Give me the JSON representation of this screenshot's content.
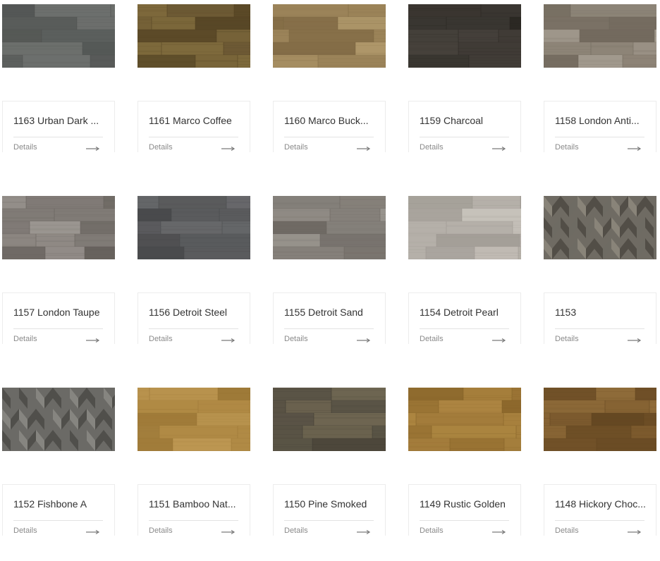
{
  "products": [
    {
      "title": "1163 Urban Dark ...",
      "details_label": "Details",
      "icon": "arrow-right-icon",
      "swatch": {
        "style": "plank",
        "base": "#6c6f6d",
        "light": "#8b8e8b",
        "dark": "#4a4d4b"
      }
    },
    {
      "title": "1161 Marco Coffee",
      "details_label": "Details",
      "icon": "arrow-right-icon",
      "swatch": {
        "style": "plank",
        "base": "#6d5a34",
        "light": "#85703f",
        "dark": "#4d3d1f"
      }
    },
    {
      "title": "1160 Marco Buck...",
      "details_label": "Details",
      "icon": "arrow-right-icon",
      "swatch": {
        "style": "plank",
        "base": "#9b8359",
        "light": "#b39c6e",
        "dark": "#7a6440"
      }
    },
    {
      "title": "1159 Charcoal",
      "details_label": "Details",
      "icon": "arrow-right-icon",
      "swatch": {
        "style": "plank",
        "base": "#3a3631",
        "light": "#4a453f",
        "dark": "#27241f"
      }
    },
    {
      "title": "1158 London Anti...",
      "details_label": "Details",
      "icon": "arrow-right-icon",
      "swatch": {
        "style": "plank",
        "base": "#8d8477",
        "light": "#aaa296",
        "dark": "#6b6357"
      }
    },
    {
      "title": "1157 London Taupe",
      "details_label": "Details",
      "icon": "arrow-right-icon",
      "swatch": {
        "style": "plank",
        "base": "#807b76",
        "light": "#a19c97",
        "dark": "#5f5a55"
      }
    },
    {
      "title": "1156 Detroit Steel",
      "details_label": "Details",
      "icon": "arrow-right-icon",
      "swatch": {
        "style": "plank",
        "base": "#5a5b5d",
        "light": "#6e6f71",
        "dark": "#454648"
      }
    },
    {
      "title": "1155 Detroit Sand",
      "details_label": "Details",
      "icon": "arrow-right-icon",
      "swatch": {
        "style": "plank",
        "base": "#85807a",
        "light": "#a09b95",
        "dark": "#67625c"
      }
    },
    {
      "title": "1154 Detroit Pearl",
      "details_label": "Details",
      "icon": "arrow-right-icon",
      "swatch": {
        "style": "plank",
        "base": "#b5b0a9",
        "light": "#cbc6bf",
        "dark": "#98938c"
      }
    },
    {
      "title": "1153",
      "details_label": "Details",
      "icon": "arrow-right-icon",
      "swatch": {
        "style": "herringbone",
        "base": "#6f6b63",
        "light": "#8e887d",
        "dark": "#4d4942"
      }
    },
    {
      "title": "1152 Fishbone A",
      "details_label": "Details",
      "icon": "arrow-right-icon",
      "swatch": {
        "style": "herringbone",
        "base": "#6b6a66",
        "light": "#8b8985",
        "dark": "#4b4a46"
      }
    },
    {
      "title": "1151 Bamboo Nat...",
      "details_label": "Details",
      "icon": "arrow-right-icon",
      "swatch": {
        "style": "plank",
        "base": "#b08a45",
        "light": "#c29d58",
        "dark": "#987434"
      }
    },
    {
      "title": "1150 Pine Smoked",
      "details_label": "Details",
      "icon": "arrow-right-icon",
      "swatch": {
        "style": "plank",
        "base": "#5a5446",
        "light": "#756c55",
        "dark": "#3c382f"
      }
    },
    {
      "title": "1149 Rustic Golden",
      "details_label": "Details",
      "icon": "arrow-right-icon",
      "swatch": {
        "style": "plank",
        "base": "#9a7434",
        "light": "#b08944",
        "dark": "#7e5c24"
      }
    },
    {
      "title": "1148 Hickory Choc...",
      "details_label": "Details",
      "icon": "arrow-right-icon",
      "swatch": {
        "style": "plank",
        "base": "#7c5a2e",
        "light": "#94703c",
        "dark": "#5f431f"
      }
    }
  ]
}
